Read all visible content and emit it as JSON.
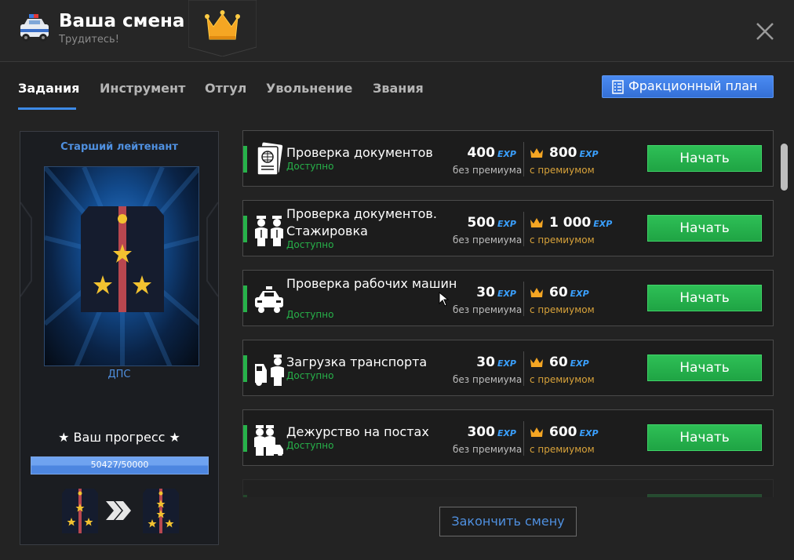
{
  "header": {
    "title": "Ваша смена",
    "subtitle": "Трудитесь!"
  },
  "tabs": [
    {
      "label": "Задания",
      "active": true
    },
    {
      "label": "Инструмент",
      "active": false
    },
    {
      "label": "Отгул",
      "active": false
    },
    {
      "label": "Увольнение",
      "active": false
    },
    {
      "label": "Звания",
      "active": false
    }
  ],
  "faction_button": {
    "label": "Фракционный план"
  },
  "rank": {
    "title": "Старший лейтенант",
    "department": "ДПС",
    "progress_label": "★ Ваш прогресс ★",
    "progress_current": 50427,
    "progress_max": 50000,
    "progress_text": "50427/50000",
    "progress_fraction": 1.0
  },
  "exp_tag": "EXP",
  "tasks": [
    {
      "name": "Проверка документов",
      "status": "Доступно",
      "exp_base": "400",
      "base_label": "без премиума",
      "exp_premium": "800",
      "premium_label": "с премиумом",
      "button": "Начать",
      "icon": "passport-icon"
    },
    {
      "name": "Проверка документов. Стажировка",
      "status": "Доступно",
      "exp_base": "500",
      "base_label": "без премиума",
      "exp_premium": "1 000",
      "premium_label": "с премиумом",
      "button": "Начать",
      "icon": "officers-icon"
    },
    {
      "name": "Проверка рабочих машин",
      "status": "Доступно",
      "exp_base": "30",
      "base_label": "без премиума",
      "exp_premium": "60",
      "premium_label": "с премиумом",
      "button": "Начать",
      "icon": "police-car-icon"
    },
    {
      "name": "Загрузка транспорта",
      "status": "Доступно",
      "exp_base": "30",
      "base_label": "без премиума",
      "exp_premium": "60",
      "premium_label": "с премиумом",
      "button": "Начать",
      "icon": "tow-icon"
    },
    {
      "name": "Дежурство на постах",
      "status": "Доступно",
      "exp_base": "300",
      "base_label": "без премиума",
      "exp_premium": "600",
      "premium_label": "с премиумом",
      "button": "Начать",
      "icon": "patrol-icon"
    }
  ],
  "end_shift_button": "Закончить смену",
  "colors": {
    "accent_blue": "#3d8ae6",
    "available_green": "#27b24a",
    "premium_gold": "#d8a23a",
    "start_button": "#2ebf56"
  }
}
